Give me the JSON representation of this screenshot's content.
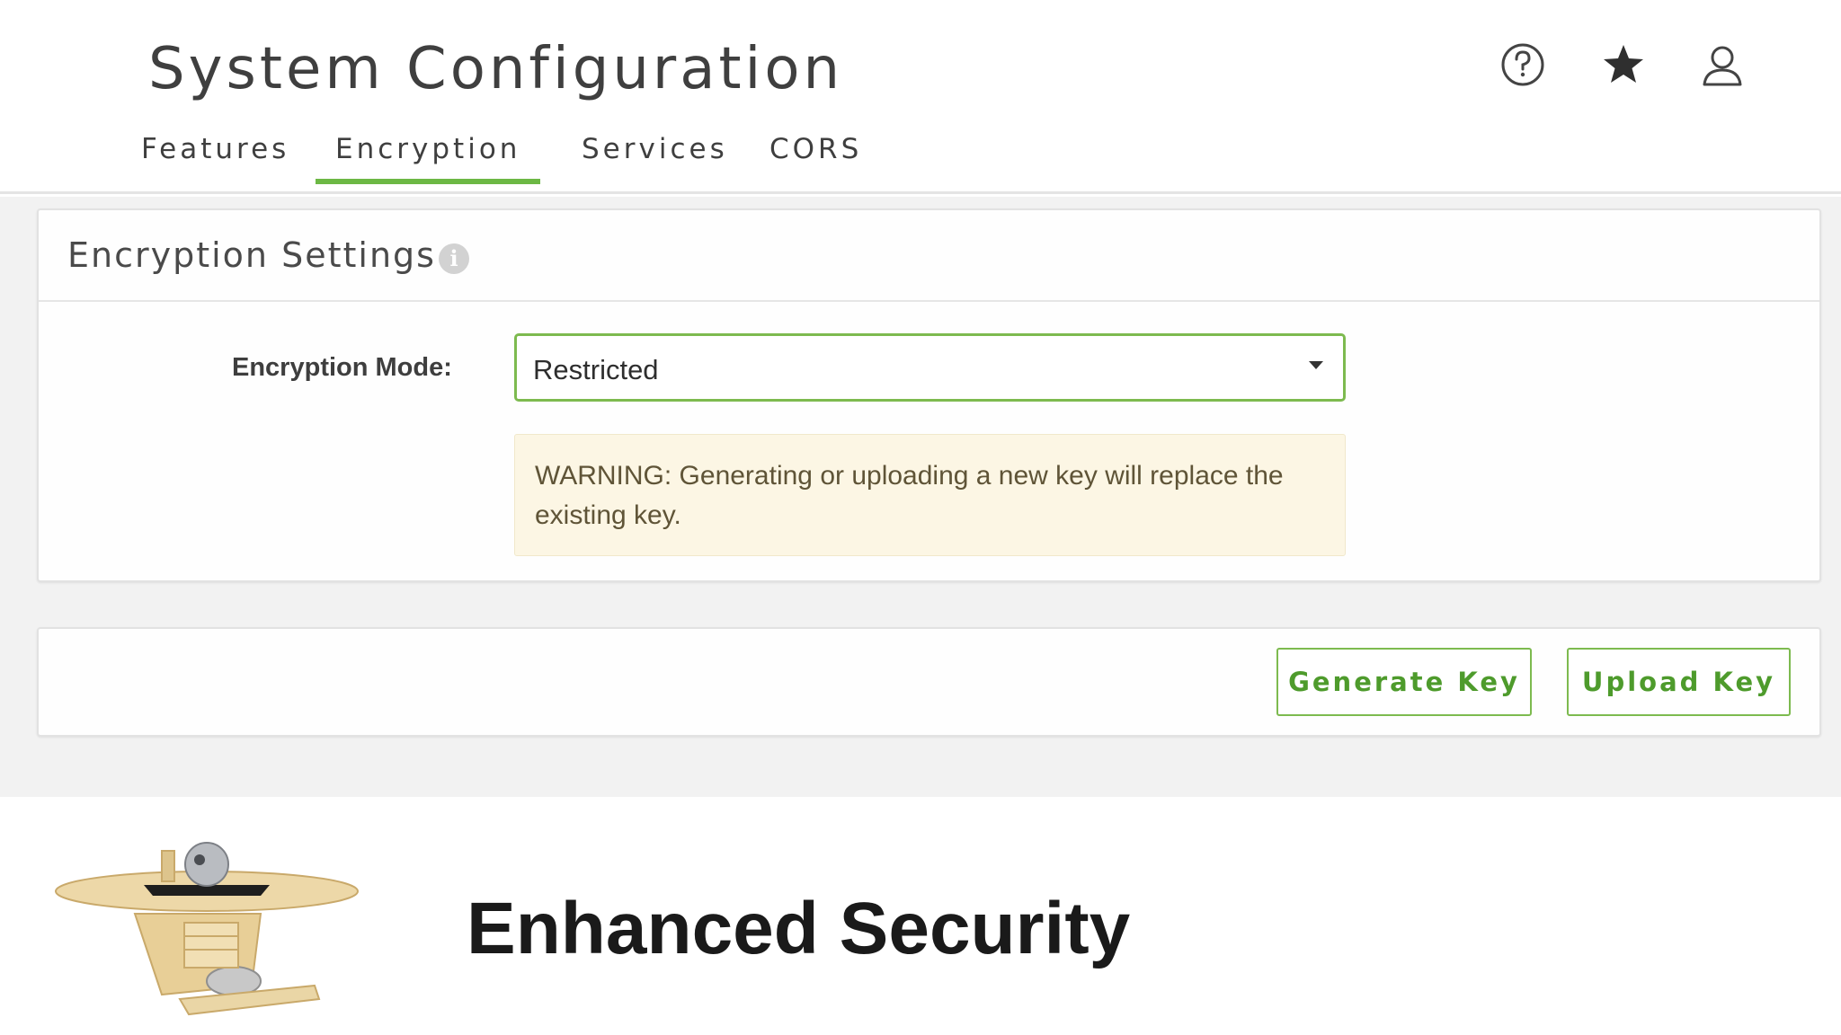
{
  "header": {
    "title": "System Configuration",
    "tabs": [
      {
        "label": "Features"
      },
      {
        "label": "Encryption"
      },
      {
        "label": "Services"
      },
      {
        "label": "CORS"
      }
    ],
    "active_tab": "Encryption",
    "icons": [
      "help-icon",
      "star-icon",
      "user-icon"
    ]
  },
  "settings_panel": {
    "title": "Encryption Settings",
    "info_glyph": "i",
    "mode_label": "Encryption Mode:",
    "mode_value": "Restricted",
    "warning": "WARNING: Generating or uploading a new key will replace the existing key."
  },
  "actions": {
    "generate_label": "Generate Key",
    "upload_label": "Upload Key"
  },
  "caption": {
    "text": "Enhanced Security"
  },
  "colors": {
    "accent": "#6cb844",
    "warning_bg": "#fcf6e4",
    "content_bg": "#f2f2f2"
  }
}
